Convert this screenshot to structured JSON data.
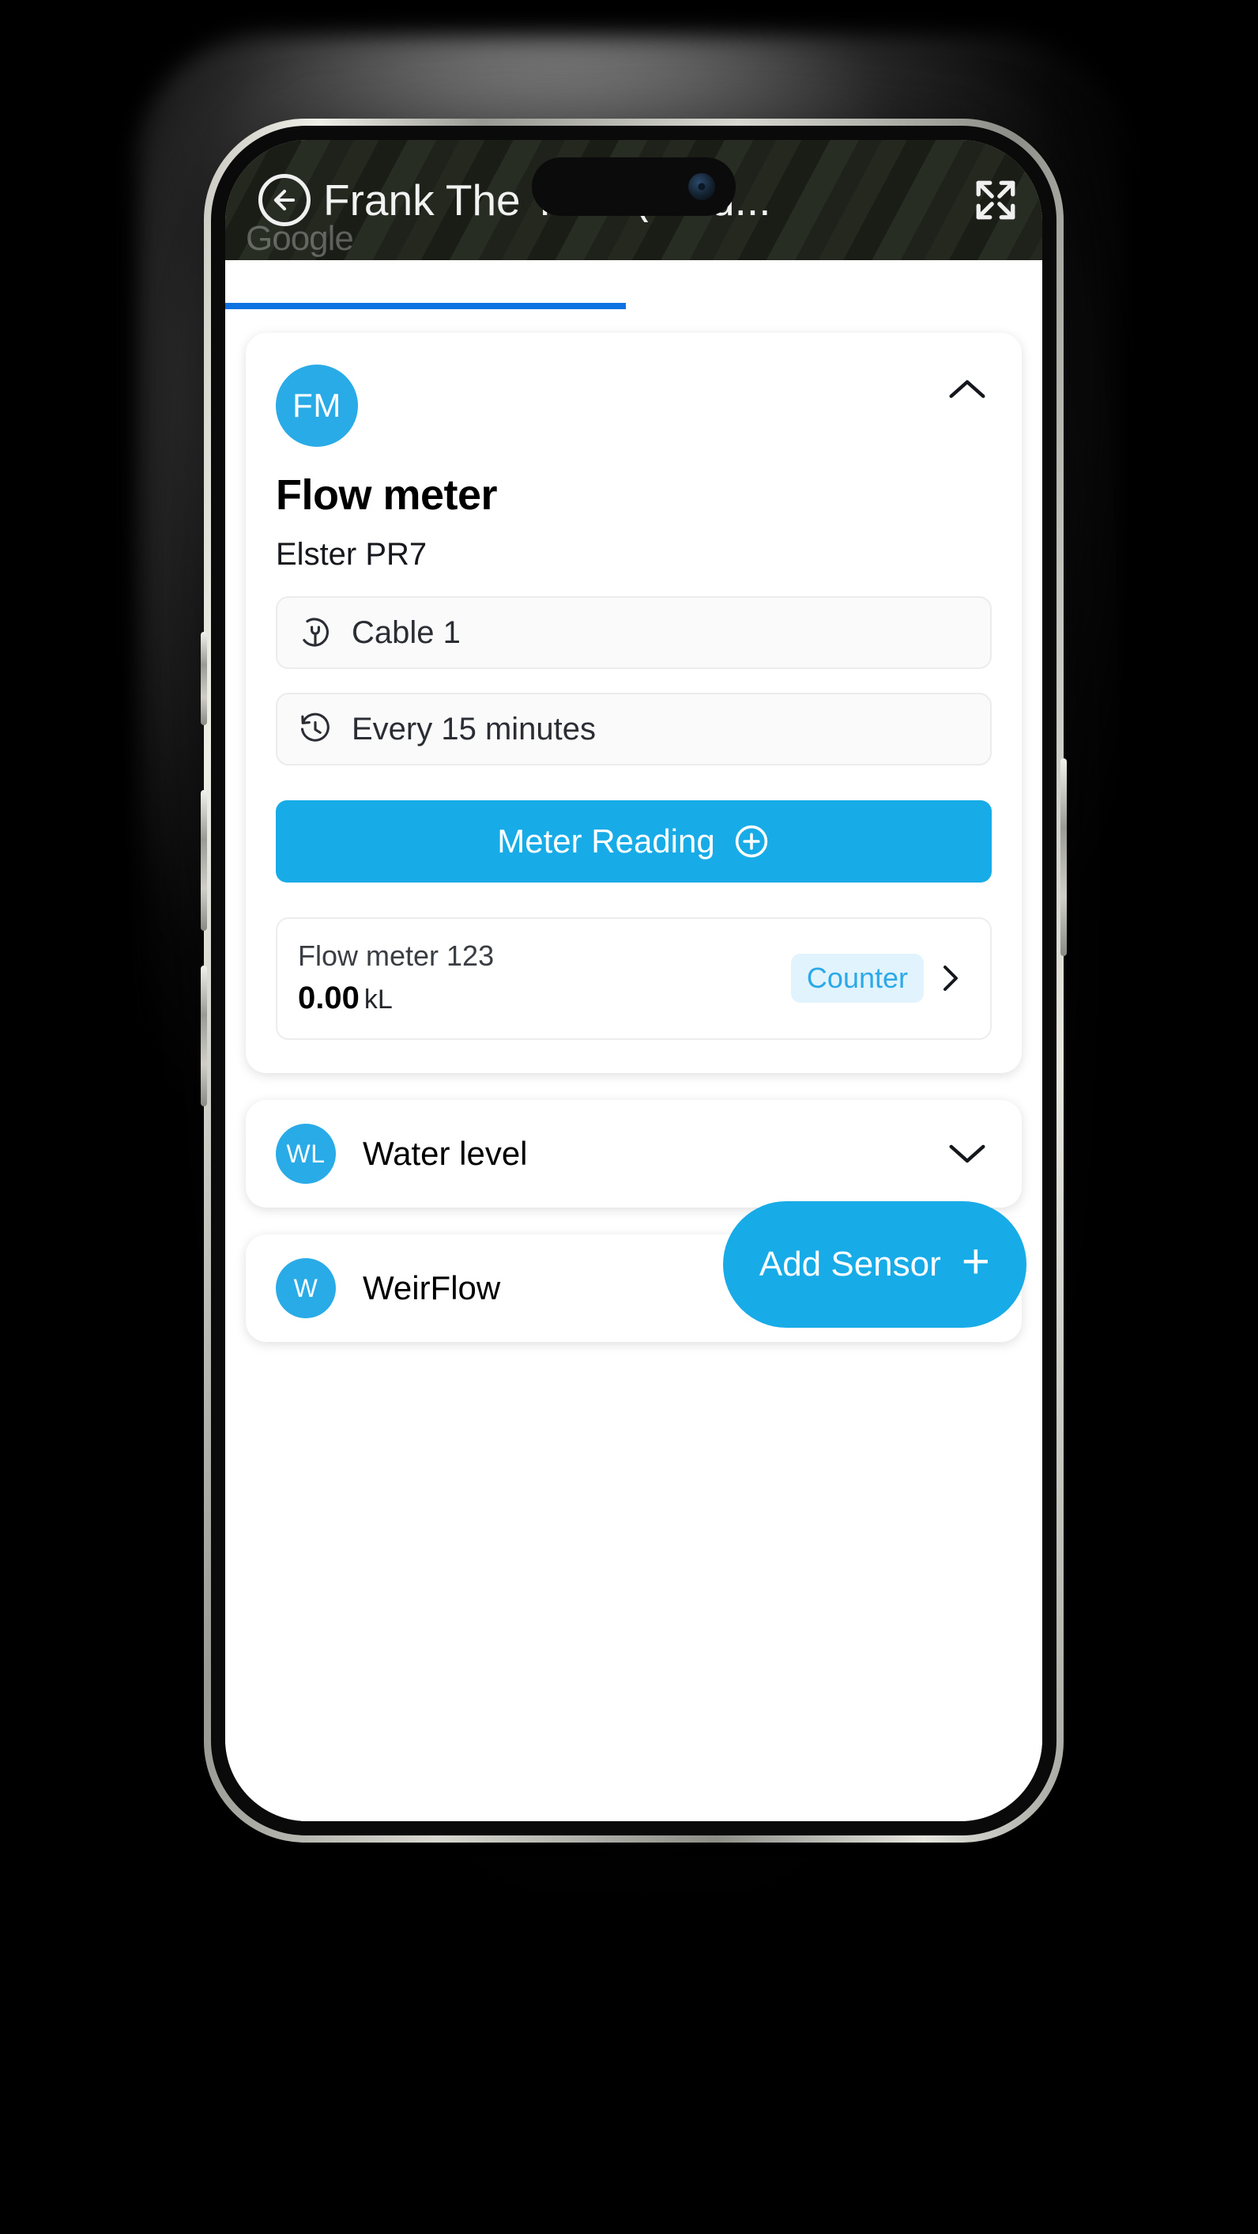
{
  "colors": {
    "brand_blue": "#17ACE8",
    "avatar_blue": "#29ABE8",
    "tab_indicator": "#0E73E0",
    "badge_bg": "#E1F3FC",
    "badge_text": "#2CA9E8"
  },
  "header": {
    "title": "Frank The Tank (Wild...",
    "back_icon": "back-arrow-circle-icon",
    "expand_icon": "fullscreen-expand-icon",
    "map_watermark": "Google"
  },
  "sensors": [
    {
      "avatar_initials": "FM",
      "name": "Flow meter",
      "model": "Elster PR7",
      "expanded": true,
      "collapse_icon": "chevron-up-icon",
      "info_rows": [
        {
          "icon": "plug-circle-icon",
          "label": "Cable 1"
        },
        {
          "icon": "history-clock-icon",
          "label": "Every 15 minutes"
        }
      ],
      "action_button": {
        "label": "Meter Reading",
        "icon": "plus-circle-icon"
      },
      "readings": [
        {
          "name": "Flow meter 123",
          "value": "0.00",
          "unit": "kL",
          "badge": "Counter",
          "chevron": "chevron-right-icon"
        }
      ]
    },
    {
      "avatar_initials": "WL",
      "name": "Water level",
      "expanded": false,
      "collapse_icon": "chevron-down-icon"
    },
    {
      "avatar_initials": "W",
      "name": "WeirFlow",
      "expanded": false
    }
  ],
  "fab": {
    "label": "Add Sensor",
    "icon": "plus-icon",
    "plus": "+"
  }
}
